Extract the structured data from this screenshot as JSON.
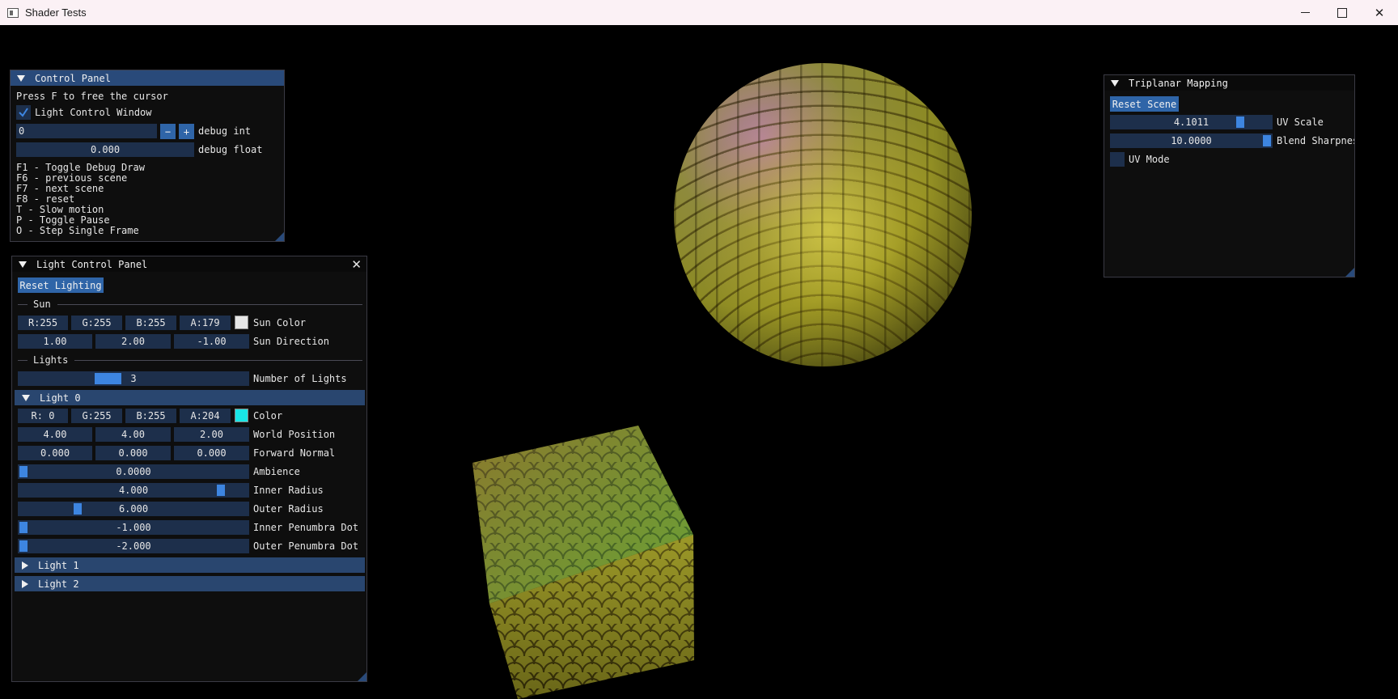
{
  "window": {
    "title": "Shader Tests",
    "close_glyph": "✕"
  },
  "control_panel": {
    "title": "Control Panel",
    "free_cursor_text": "Press F to free the cursor",
    "light_control_checkbox": {
      "label": "Light Control Window",
      "checked": true
    },
    "debug_int": {
      "value": "0",
      "minus": "−",
      "plus": "+",
      "label": "debug int"
    },
    "debug_float": {
      "value": "0.000",
      "label": "debug float"
    },
    "help_lines": [
      "F1 - Toggle Debug Draw",
      "F6 - previous scene",
      "F7 - next scene",
      "F8 - reset",
      "T - Slow motion",
      "P - Toggle Pause",
      "O - Step Single Frame"
    ]
  },
  "light_panel": {
    "title": "Light Control Panel",
    "close_glyph": "✕",
    "reset_button": "Reset Lighting",
    "sun_section": "Sun",
    "sun_color": {
      "r": "R:255",
      "g": "G:255",
      "b": "B:255",
      "a": "A:179",
      "label": "Sun Color",
      "swatch": "#e6e6e6"
    },
    "sun_direction": {
      "x": "1.00",
      "y": "2.00",
      "z": "-1.00",
      "label": "Sun Direction"
    },
    "lights_section": "Lights",
    "num_lights": {
      "value": "3",
      "label": "Number of Lights",
      "fraction": 0.4
    },
    "light0": {
      "header": "Light 0",
      "color": {
        "r": "R:  0",
        "g": "G:255",
        "b": "B:255",
        "a": "A:204",
        "label": "Color",
        "swatch": "#19e6e6"
      },
      "world_position": {
        "x": "4.00",
        "y": "4.00",
        "z": "2.00",
        "label": "World Position"
      },
      "forward_normal": {
        "x": "0.000",
        "y": "0.000",
        "z": "0.000",
        "label": "Forward Normal"
      },
      "ambience": {
        "value": "0.0000",
        "label": "Ambience",
        "fraction": 0.0
      },
      "inner_radius": {
        "value": "4.000",
        "label": "Inner Radius",
        "fraction": 0.9
      },
      "outer_radius": {
        "value": "6.000",
        "label": "Outer Radius",
        "fraction": 0.25
      },
      "inner_penumbra": {
        "value": "-1.000",
        "label": "Inner Penumbra Dot",
        "fraction": 0.0
      },
      "outer_penumbra": {
        "value": "-2.000",
        "label": "Outer Penumbra Dot",
        "fraction": 0.0
      }
    },
    "light1": {
      "header": "Light 1"
    },
    "light2": {
      "header": "Light 2"
    }
  },
  "triplanar": {
    "title": "Triplanar Mapping",
    "reset_button": "Reset Scene",
    "uv_scale": {
      "value": "4.1011",
      "label": "UV Scale",
      "fraction": 0.78
    },
    "blend_sharpness": {
      "value": "10.0000",
      "label": "Blend Sharpnes",
      "fraction": 1.0
    },
    "uv_mode": {
      "label": "UV Mode",
      "checked": false
    }
  }
}
